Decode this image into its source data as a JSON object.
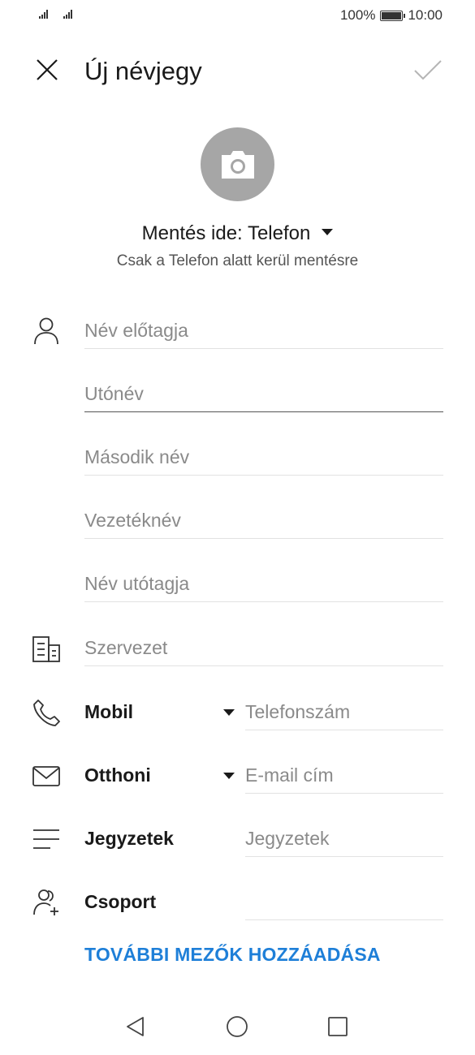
{
  "status_bar": {
    "battery": "100%",
    "time": "10:00",
    "battery_level": 1.0
  },
  "header": {
    "title": "Új névjegy",
    "close_icon": "close-icon",
    "confirm_icon": "check-icon"
  },
  "photo": {
    "icon": "camera-icon",
    "bg_color": "#a6a6a6"
  },
  "save_location": {
    "label": "Mentés ide: Telefon",
    "note": "Csak a Telefon alatt kerül mentésre"
  },
  "name_fields": {
    "prefix": "Név előtagja",
    "first": "Utónév",
    "middle": "Második név",
    "last": "Vezetéknév",
    "suffix": "Név utótagja"
  },
  "organization": {
    "placeholder": "Szervezet"
  },
  "phone": {
    "type": "Mobil",
    "placeholder": "Telefonszám"
  },
  "email": {
    "type": "Otthoni",
    "placeholder": "E-mail cím"
  },
  "notes": {
    "label": "Jegyzetek",
    "placeholder": "Jegyzetek"
  },
  "group": {
    "label": "Csoport"
  },
  "add_fields": {
    "label": "TOVÁBBI MEZŐK HOZZÁADÁSA",
    "color": "#1e7fd8"
  },
  "nav": {
    "back_icon": "back-triangle-icon",
    "home_icon": "home-circle-icon",
    "recents_icon": "recents-square-icon"
  }
}
